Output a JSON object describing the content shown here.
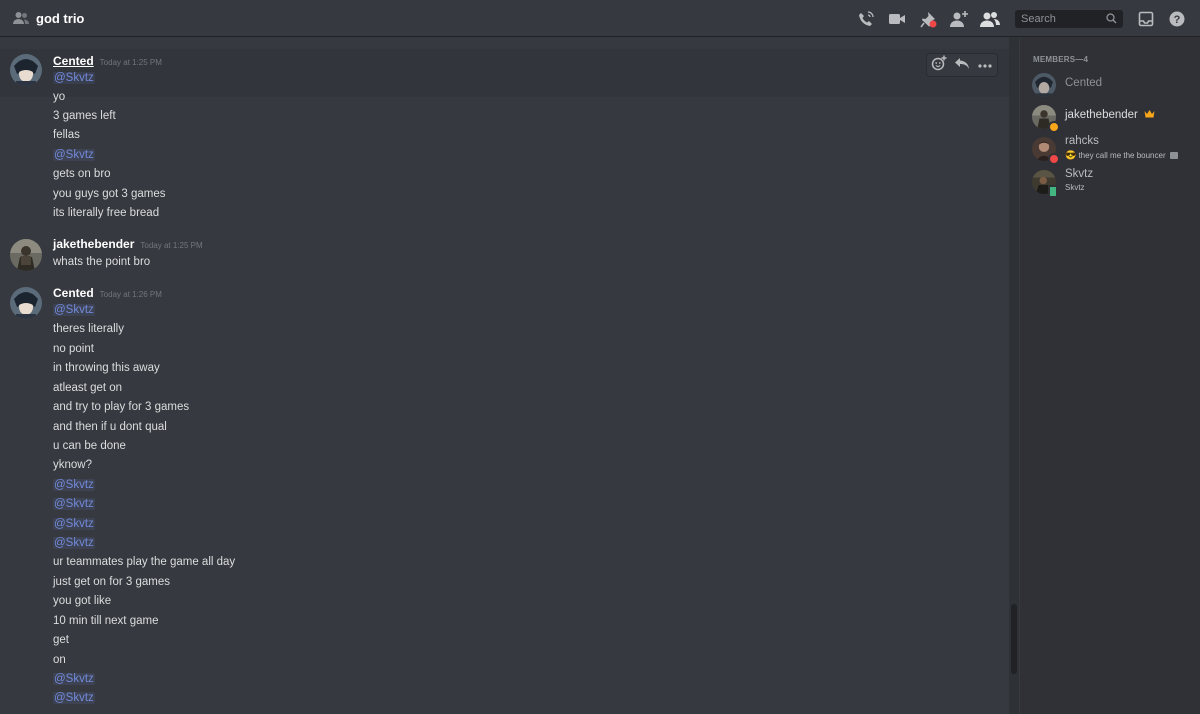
{
  "header": {
    "title": "god trio",
    "search_placeholder": "Search",
    "icons": [
      "group-icon",
      "call-icon",
      "video-icon",
      "pin-icon",
      "add-friend-icon",
      "members-icon",
      "search-icon",
      "inbox-icon",
      "help-icon"
    ]
  },
  "messages": [
    {
      "author": "Cented",
      "timestamp": "Today at 1:25 PM",
      "lines": [
        "@Skvtz",
        "yo",
        "3 games left",
        "fellas",
        "@Skvtz",
        "gets on bro",
        "you guys got 3 games",
        "its literally free bread"
      ]
    },
    {
      "author": "jakethebender",
      "timestamp": "Today at 1:25 PM",
      "lines": [
        "whats the point bro"
      ]
    },
    {
      "author": "Cented",
      "timestamp": "Today at 1:26 PM",
      "lines": [
        "@Skvtz",
        "theres literally",
        "no point",
        "in throwing this away",
        "atleast get on",
        "and try to play for 3 games",
        "and then if u dont qual",
        "u can be done",
        "yknow?",
        "@Skvtz",
        "@Skvtz",
        "@Skvtz",
        "@Skvtz",
        "ur teammates play the game all day",
        "just get on for 3 games",
        "you got like",
        "10 min till next game",
        "get",
        "on",
        "@Skvtz",
        "@Skvtz"
      ]
    }
  ],
  "message_toolbar_icons": [
    "add-reaction-icon",
    "reply-icon",
    "more-options-icon"
  ],
  "members": {
    "header": "MEMBERS—4",
    "list": [
      {
        "name": "Cented",
        "subtext": "",
        "status": "offline",
        "color": "#8e9297"
      },
      {
        "name": "jakethebender",
        "subtext": "",
        "status": "idle",
        "color": "#dcddde",
        "badge": "crown-icon"
      },
      {
        "name": "rahcks",
        "subtext": "they call me the bouncer",
        "status": "dnd",
        "color": "#b9bbbe",
        "emoji": "😎"
      },
      {
        "name": "Skvtz",
        "subtext": "Skvtz",
        "status": "mobile-online",
        "color": "#b9bbbe"
      }
    ]
  },
  "colors": {
    "background": "#36393f",
    "members_bg": "#2f3136",
    "mention": "#7289da",
    "idle": "#faa61a",
    "dnd": "#f04747",
    "online": "#43b581",
    "crown": "#faa61a"
  }
}
